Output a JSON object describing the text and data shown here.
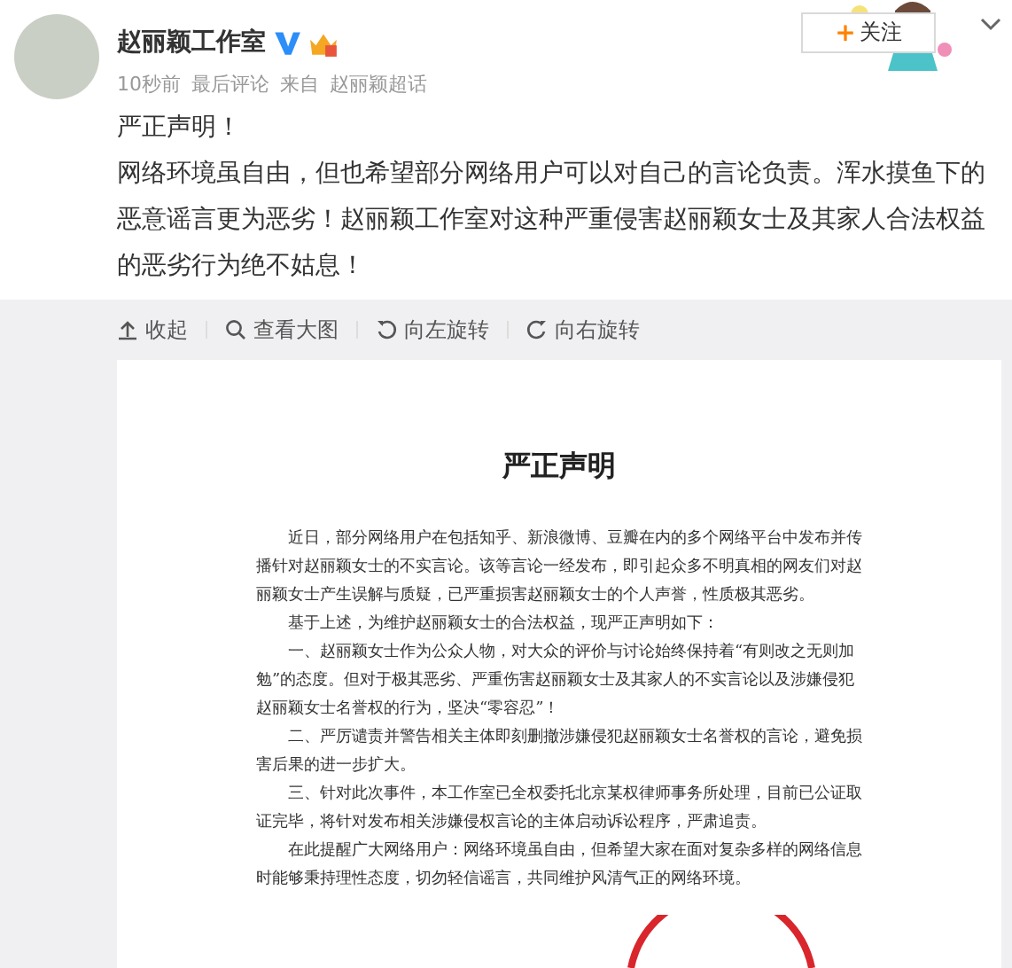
{
  "post": {
    "author": "赵丽颖工作室",
    "verified": true,
    "meta": [
      "10秒前",
      "最后评论",
      "来自",
      "赵丽颖超话"
    ],
    "follow_button": {
      "icon": "+",
      "label": "关注"
    },
    "paragraphs": [
      "严正声明！",
      "网络环境虽自由，但也希望部分网络用户可以对自己的言论负责。浑水摸鱼下的恶意谣言更为恶劣！赵丽颖工作室对这种严重侵害赵丽颖女士及其家人合法权益的恶劣行为绝不姑息！"
    ]
  },
  "image_toolbar": [
    {
      "kind": "collapse",
      "label": "收起"
    },
    {
      "kind": "zoom",
      "label": "查看大图"
    },
    {
      "kind": "rotate-left",
      "label": "向左旋转"
    },
    {
      "kind": "rotate-right",
      "label": "向右旋转"
    }
  ],
  "document": {
    "title": "严正声明",
    "paragraphs": [
      "近日，部分网络用户在包括知乎、新浪微博、豆瓣在内的多个网络平台中发布并传播针对赵丽颖女士的不实言论。该等言论一经发布，即引起众多不明真相的网友们对赵丽颖女士产生误解与质疑，已严重损害赵丽颖女士的个人声誉，性质极其恶劣。",
      "基于上述，为维护赵丽颖女士的合法权益，现严正声明如下：",
      "一、赵丽颖女士作为公众人物，对大众的评价与讨论始终保持着“有则改之无则加勉”的态度。但对于极其恶劣、严重伤害赵丽颖女士及其家人的不实言论以及涉嫌侵犯赵丽颖女士名誉权的行为，坚决“零容忍”！",
      "二、严厉谴责并警告相关主体即刻删撤涉嫌侵犯赵丽颖女士名誉权的言论，避免损害后果的进一步扩大。",
      "三、针对此次事件，本工作室已全权委托北京某权律师事务所处理，目前已公证取证完毕，将针对发布相关涉嫌侵权言论的主体启动诉讼程序，严肃追责。",
      "在此提醒广大网络用户：网络环境虽自由，但希望大家在面对复杂多样的网络信息时能够秉持理性态度，切勿轻信谣言，共同维护风清气正的网络环境。"
    ]
  }
}
